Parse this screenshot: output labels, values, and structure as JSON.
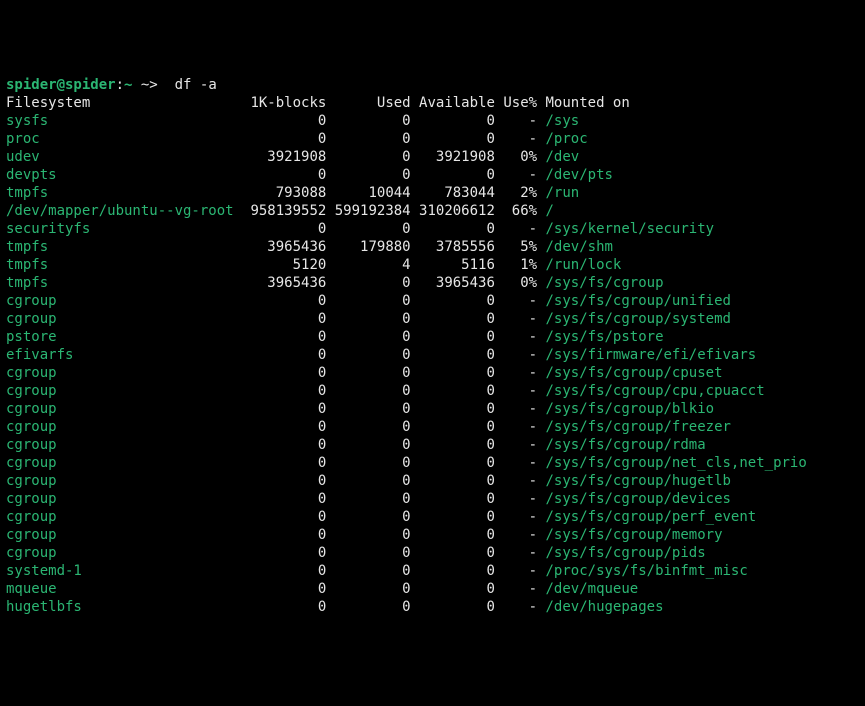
{
  "prompt": {
    "user": "spider@spider",
    "sep1": ":",
    "path": "~",
    "arrow": " ~>  ",
    "command": "df -a"
  },
  "columns": {
    "filesystem": "Filesystem",
    "blocks": "1K-blocks",
    "used": "Used",
    "available": "Available",
    "usepct": "Use%",
    "mounted": "Mounted on"
  },
  "rows": [
    {
      "fs": "sysfs",
      "blocks": "0",
      "used": "0",
      "avail": "0",
      "pct": "-",
      "mnt": "/sys"
    },
    {
      "fs": "proc",
      "blocks": "0",
      "used": "0",
      "avail": "0",
      "pct": "-",
      "mnt": "/proc"
    },
    {
      "fs": "udev",
      "blocks": "3921908",
      "used": "0",
      "avail": "3921908",
      "pct": "0%",
      "mnt": "/dev"
    },
    {
      "fs": "devpts",
      "blocks": "0",
      "used": "0",
      "avail": "0",
      "pct": "-",
      "mnt": "/dev/pts"
    },
    {
      "fs": "tmpfs",
      "blocks": "793088",
      "used": "10044",
      "avail": "783044",
      "pct": "2%",
      "mnt": "/run"
    },
    {
      "fs": "/dev/mapper/ubuntu--vg-root",
      "blocks": "958139552",
      "used": "599192384",
      "avail": "310206612",
      "pct": "66%",
      "mnt": "/"
    },
    {
      "fs": "securityfs",
      "blocks": "0",
      "used": "0",
      "avail": "0",
      "pct": "-",
      "mnt": "/sys/kernel/security"
    },
    {
      "fs": "tmpfs",
      "blocks": "3965436",
      "used": "179880",
      "avail": "3785556",
      "pct": "5%",
      "mnt": "/dev/shm"
    },
    {
      "fs": "tmpfs",
      "blocks": "5120",
      "used": "4",
      "avail": "5116",
      "pct": "1%",
      "mnt": "/run/lock"
    },
    {
      "fs": "tmpfs",
      "blocks": "3965436",
      "used": "0",
      "avail": "3965436",
      "pct": "0%",
      "mnt": "/sys/fs/cgroup"
    },
    {
      "fs": "cgroup",
      "blocks": "0",
      "used": "0",
      "avail": "0",
      "pct": "-",
      "mnt": "/sys/fs/cgroup/unified"
    },
    {
      "fs": "cgroup",
      "blocks": "0",
      "used": "0",
      "avail": "0",
      "pct": "-",
      "mnt": "/sys/fs/cgroup/systemd"
    },
    {
      "fs": "pstore",
      "blocks": "0",
      "used": "0",
      "avail": "0",
      "pct": "-",
      "mnt": "/sys/fs/pstore"
    },
    {
      "fs": "efivarfs",
      "blocks": "0",
      "used": "0",
      "avail": "0",
      "pct": "-",
      "mnt": "/sys/firmware/efi/efivars"
    },
    {
      "fs": "cgroup",
      "blocks": "0",
      "used": "0",
      "avail": "0",
      "pct": "-",
      "mnt": "/sys/fs/cgroup/cpuset"
    },
    {
      "fs": "cgroup",
      "blocks": "0",
      "used": "0",
      "avail": "0",
      "pct": "-",
      "mnt": "/sys/fs/cgroup/cpu,cpuacct"
    },
    {
      "fs": "cgroup",
      "blocks": "0",
      "used": "0",
      "avail": "0",
      "pct": "-",
      "mnt": "/sys/fs/cgroup/blkio"
    },
    {
      "fs": "cgroup",
      "blocks": "0",
      "used": "0",
      "avail": "0",
      "pct": "-",
      "mnt": "/sys/fs/cgroup/freezer"
    },
    {
      "fs": "cgroup",
      "blocks": "0",
      "used": "0",
      "avail": "0",
      "pct": "-",
      "mnt": "/sys/fs/cgroup/rdma"
    },
    {
      "fs": "cgroup",
      "blocks": "0",
      "used": "0",
      "avail": "0",
      "pct": "-",
      "mnt": "/sys/fs/cgroup/net_cls,net_prio"
    },
    {
      "fs": "cgroup",
      "blocks": "0",
      "used": "0",
      "avail": "0",
      "pct": "-",
      "mnt": "/sys/fs/cgroup/hugetlb"
    },
    {
      "fs": "cgroup",
      "blocks": "0",
      "used": "0",
      "avail": "0",
      "pct": "-",
      "mnt": "/sys/fs/cgroup/devices"
    },
    {
      "fs": "cgroup",
      "blocks": "0",
      "used": "0",
      "avail": "0",
      "pct": "-",
      "mnt": "/sys/fs/cgroup/perf_event"
    },
    {
      "fs": "cgroup",
      "blocks": "0",
      "used": "0",
      "avail": "0",
      "pct": "-",
      "mnt": "/sys/fs/cgroup/memory"
    },
    {
      "fs": "cgroup",
      "blocks": "0",
      "used": "0",
      "avail": "0",
      "pct": "-",
      "mnt": "/sys/fs/cgroup/pids"
    },
    {
      "fs": "systemd-1",
      "blocks": "0",
      "used": "0",
      "avail": "0",
      "pct": "-",
      "mnt": "/proc/sys/fs/binfmt_misc"
    },
    {
      "fs": "mqueue",
      "blocks": "0",
      "used": "0",
      "avail": "0",
      "pct": "-",
      "mnt": "/dev/mqueue"
    },
    {
      "fs": "hugetlbfs",
      "blocks": "0",
      "used": "0",
      "avail": "0",
      "pct": "-",
      "mnt": "/dev/hugepages"
    }
  ],
  "widths": {
    "fs": 27,
    "blocks": 10,
    "used": 10,
    "avail": 10,
    "pct": 5
  }
}
